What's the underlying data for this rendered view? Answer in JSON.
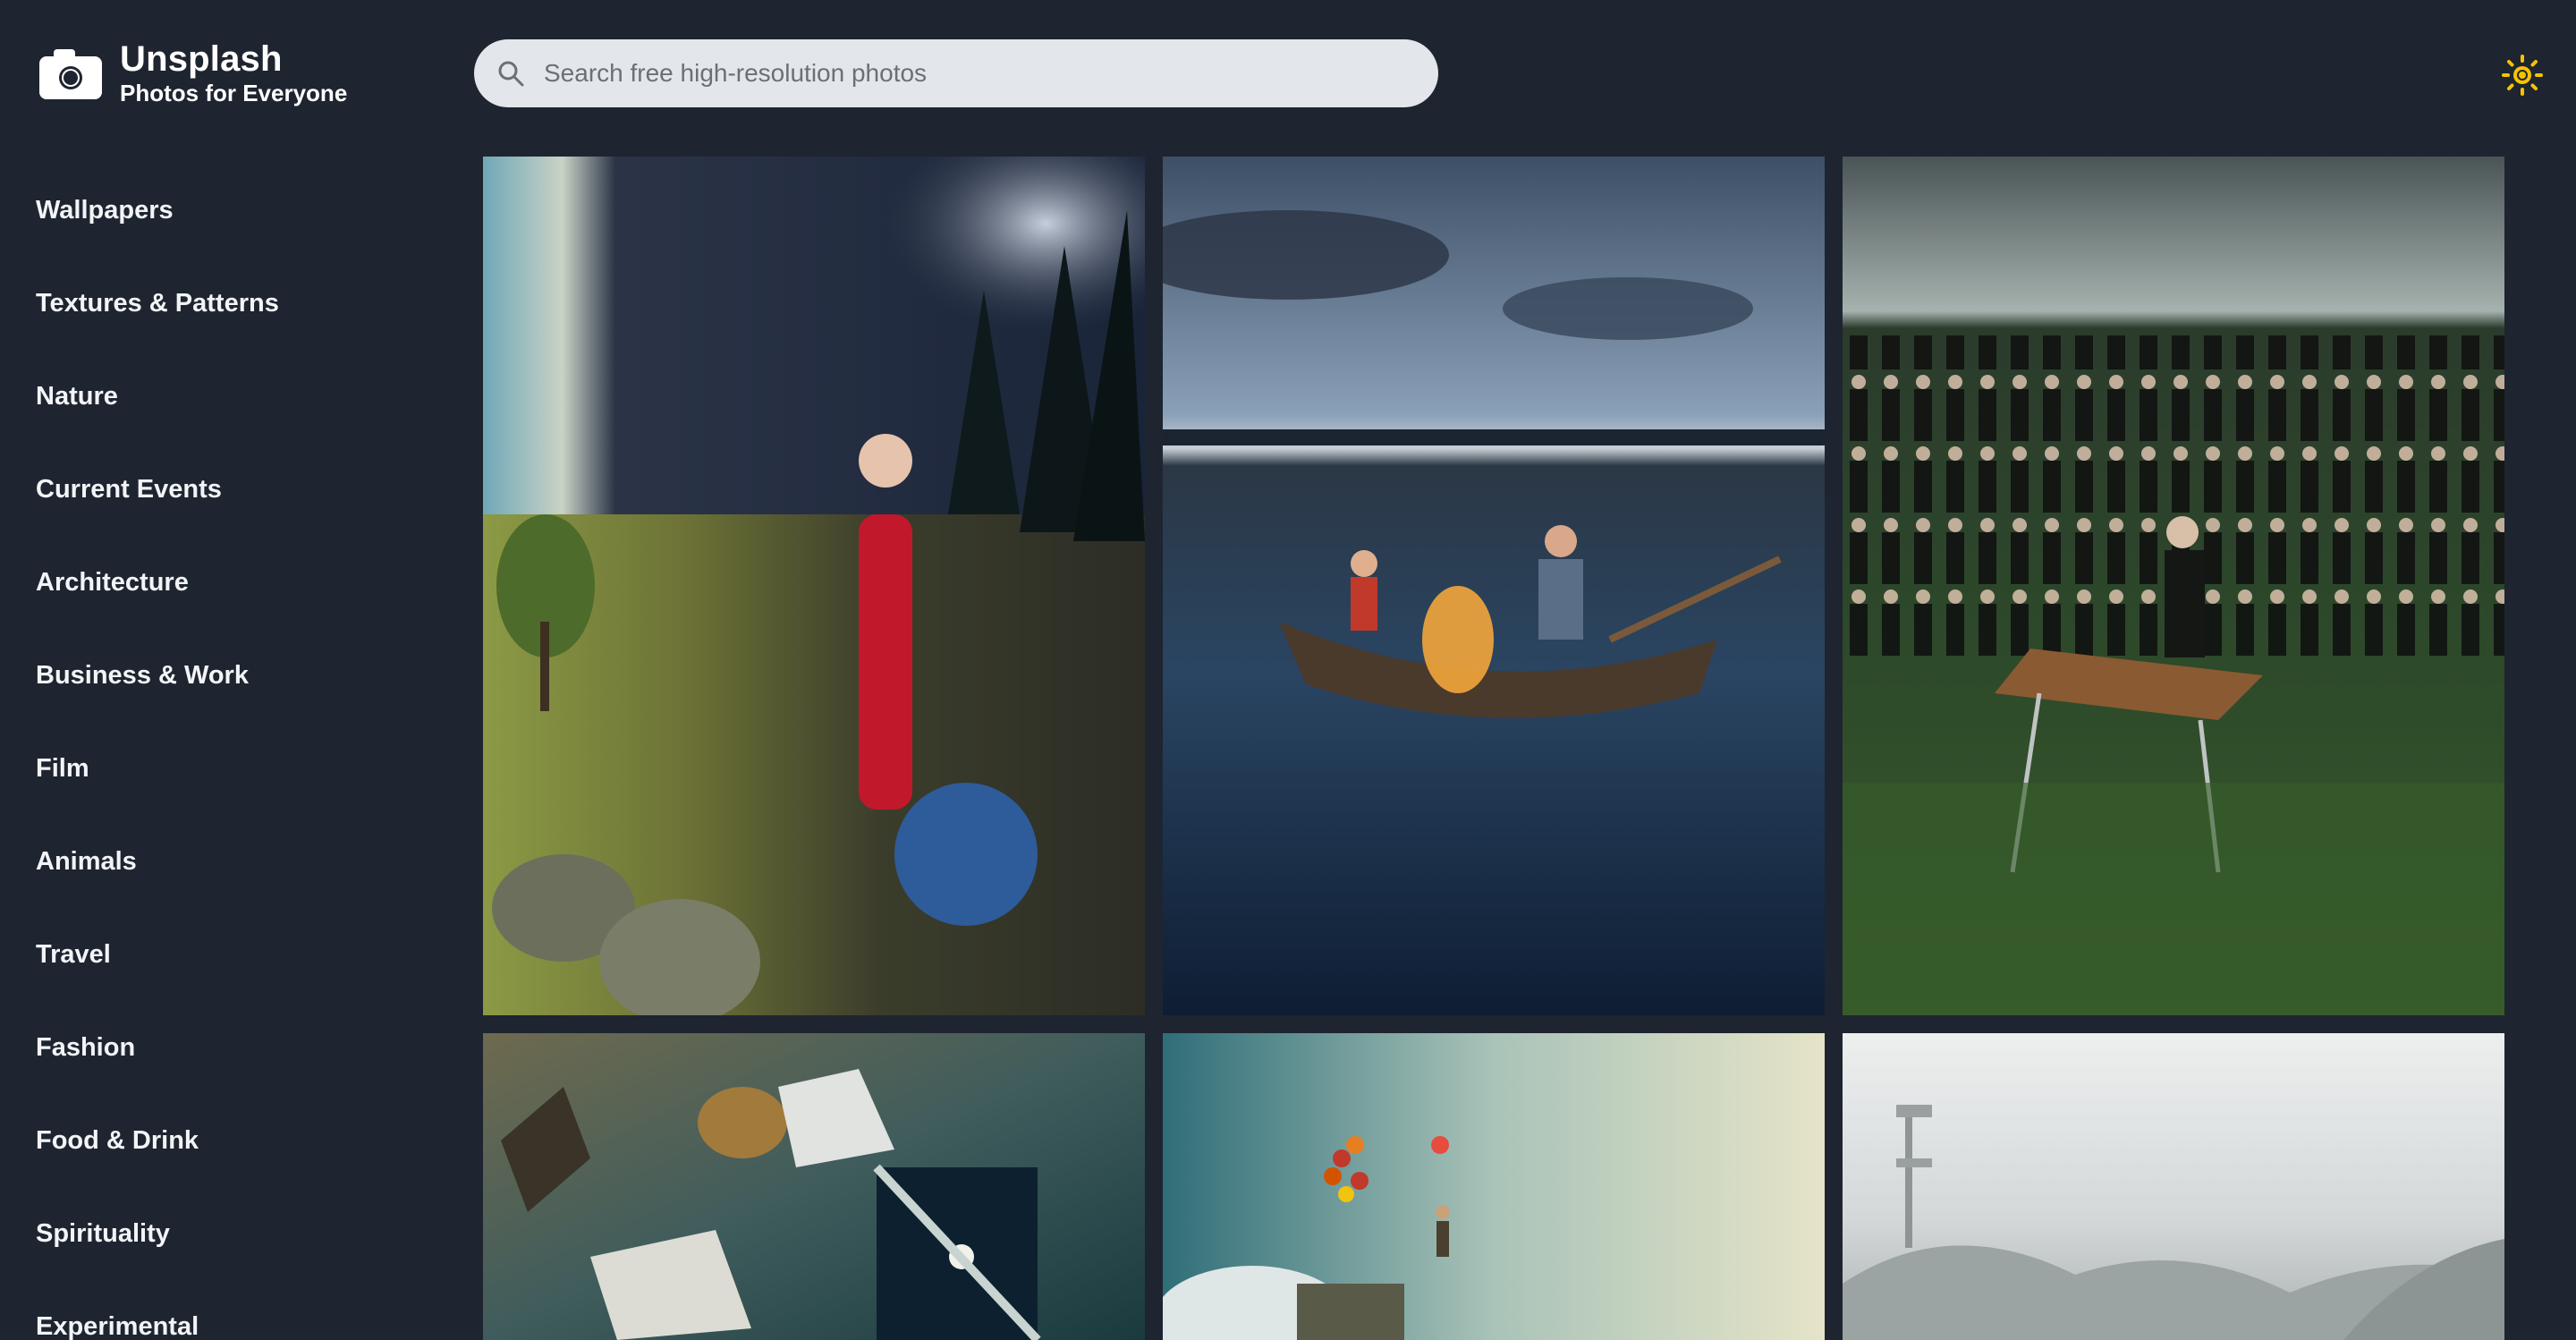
{
  "brand": {
    "name": "Unsplash",
    "tagline": "Photos for Everyone",
    "icon": "camera-icon"
  },
  "search": {
    "placeholder": "Search free high-resolution photos",
    "value": "",
    "icon": "search-icon"
  },
  "theme_toggle": {
    "icon": "sun-icon",
    "accent": "#f5c400"
  },
  "sidebar": {
    "items": [
      {
        "label": "Wallpapers"
      },
      {
        "label": "Textures & Patterns"
      },
      {
        "label": "Nature"
      },
      {
        "label": "Current Events"
      },
      {
        "label": "Architecture"
      },
      {
        "label": "Business & Work"
      },
      {
        "label": "Film"
      },
      {
        "label": "Animals"
      },
      {
        "label": "Travel"
      },
      {
        "label": "Fashion"
      },
      {
        "label": "Food & Drink"
      },
      {
        "label": "Spirituality"
      },
      {
        "label": "Experimental"
      }
    ]
  },
  "colors": {
    "background": "#1e2530",
    "search_bg": "#e3e6ea",
    "text": "#ffffff"
  },
  "photos": [
    {
      "name": "photo-night-day-wanderer"
    },
    {
      "name": "photo-boat-campfire-lake"
    },
    {
      "name": "photo-crowd-desk-field"
    },
    {
      "name": "photo-flying-books-room"
    },
    {
      "name": "photo-balloons-sky"
    },
    {
      "name": "photo-foggy-landscape"
    }
  ]
}
